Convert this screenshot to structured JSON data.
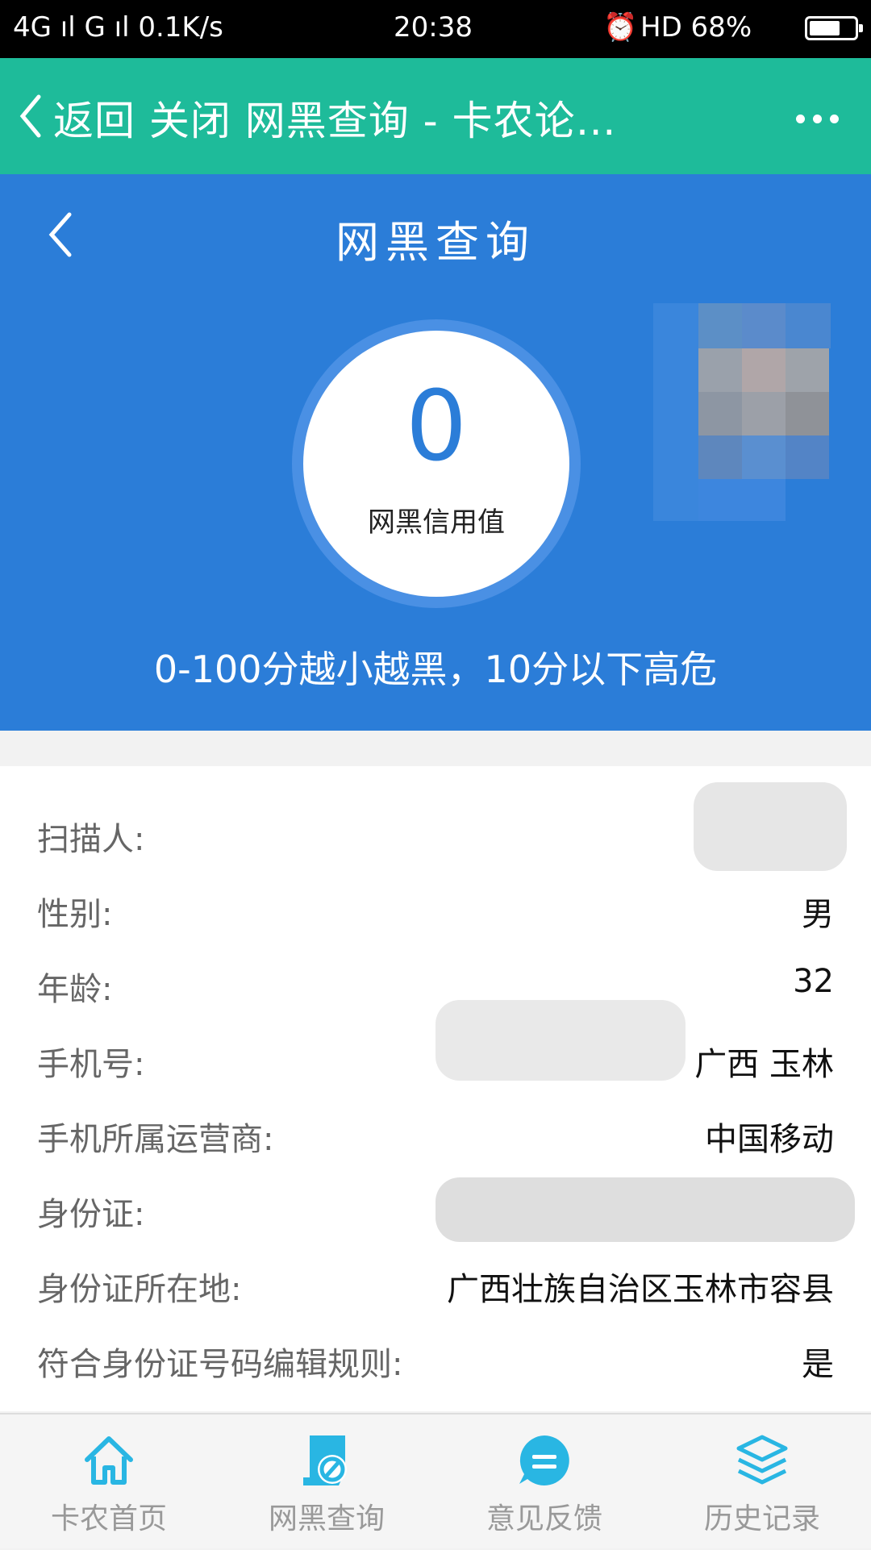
{
  "statusbar": {
    "left": "4G ıl G ıl 0.1K/s",
    "time": "20:38",
    "right": "HD 68%",
    "battery_level": 0.68
  },
  "wechat": {
    "title": "返回 关闭 网黑查询 - 卡农论…"
  },
  "hero": {
    "title": "网黑查询",
    "score": "0",
    "score_label": "网黑信用值",
    "note": "0-100分越小越黑，10分以下高危"
  },
  "details": [
    {
      "label": "扫描人:",
      "value": ""
    },
    {
      "label": "性别:",
      "value": "男"
    },
    {
      "label": "年龄:",
      "value": "32"
    },
    {
      "label": "手机号:",
      "value": "广西 玉林"
    },
    {
      "label": "手机所属运营商:",
      "value": "中国移动"
    },
    {
      "label": "身份证:",
      "value": ""
    },
    {
      "label": "身份证所在地:",
      "value": "广西壮族自治区玉林市容县"
    },
    {
      "label": "符合身份证号码编辑规则:",
      "value": "是"
    }
  ],
  "tabs": [
    {
      "label": "卡农首页",
      "icon": "home-icon"
    },
    {
      "label": "网黑查询",
      "icon": "blacklist-search-icon"
    },
    {
      "label": "意见反馈",
      "icon": "feedback-icon"
    },
    {
      "label": "历史记录",
      "icon": "history-layers-icon"
    }
  ],
  "colors": {
    "wechat_bar": "#1ebb9a",
    "hero": "#2b7dd8",
    "tab_icon": "#29b6e3"
  }
}
